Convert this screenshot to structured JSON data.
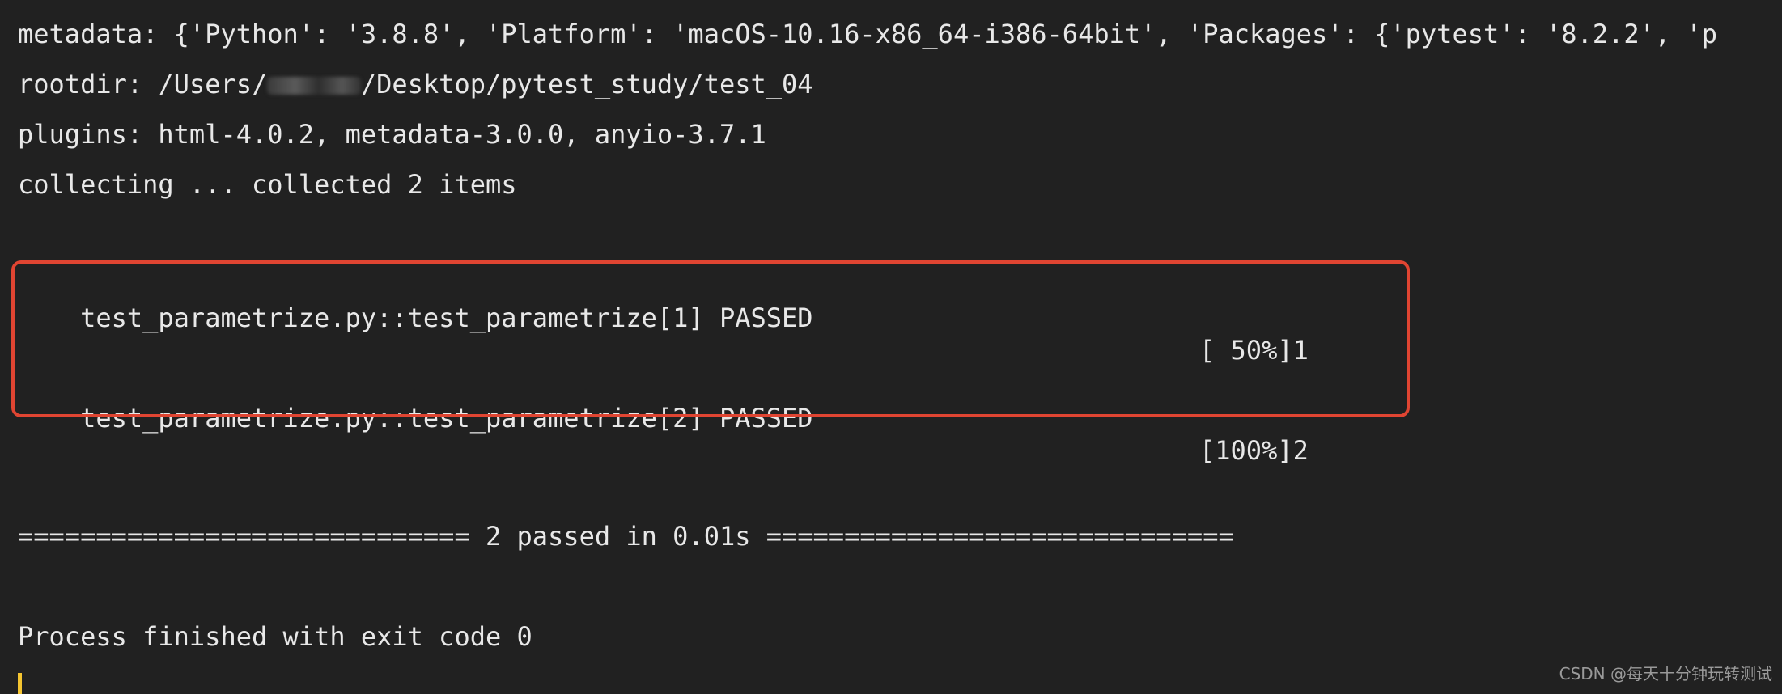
{
  "terminal": {
    "metadata_line": "metadata: {'Python': '3.8.8', 'Platform': 'macOS-10.16-x86_64-i386-64bit', 'Packages': {'pytest': '8.2.2', 'p",
    "rootdir_prefix": "rootdir: /Users/",
    "rootdir_redacted": "yyyyyy",
    "rootdir_suffix": "/Desktop/pytest_study/test_04",
    "plugins_line": "plugins: html-4.0.2, metadata-3.0.0, anyio-3.7.1",
    "collecting_line": "collecting ... collected 2 items",
    "results": [
      {
        "test": "test_parametrize.py::test_parametrize[1] PASSED",
        "progress": "[ 50%]1"
      },
      {
        "test": "test_parametrize.py::test_parametrize[2] PASSED",
        "progress": "[100%]2"
      }
    ],
    "summary_line": "============================= 2 passed in 0.01s ==============================",
    "exit_line": "Process finished with exit code 0"
  },
  "highlight": {
    "color": "#e04532"
  },
  "cursor": {
    "color": "#f4c430"
  },
  "watermark": "CSDN @每天十分钟玩转测试"
}
